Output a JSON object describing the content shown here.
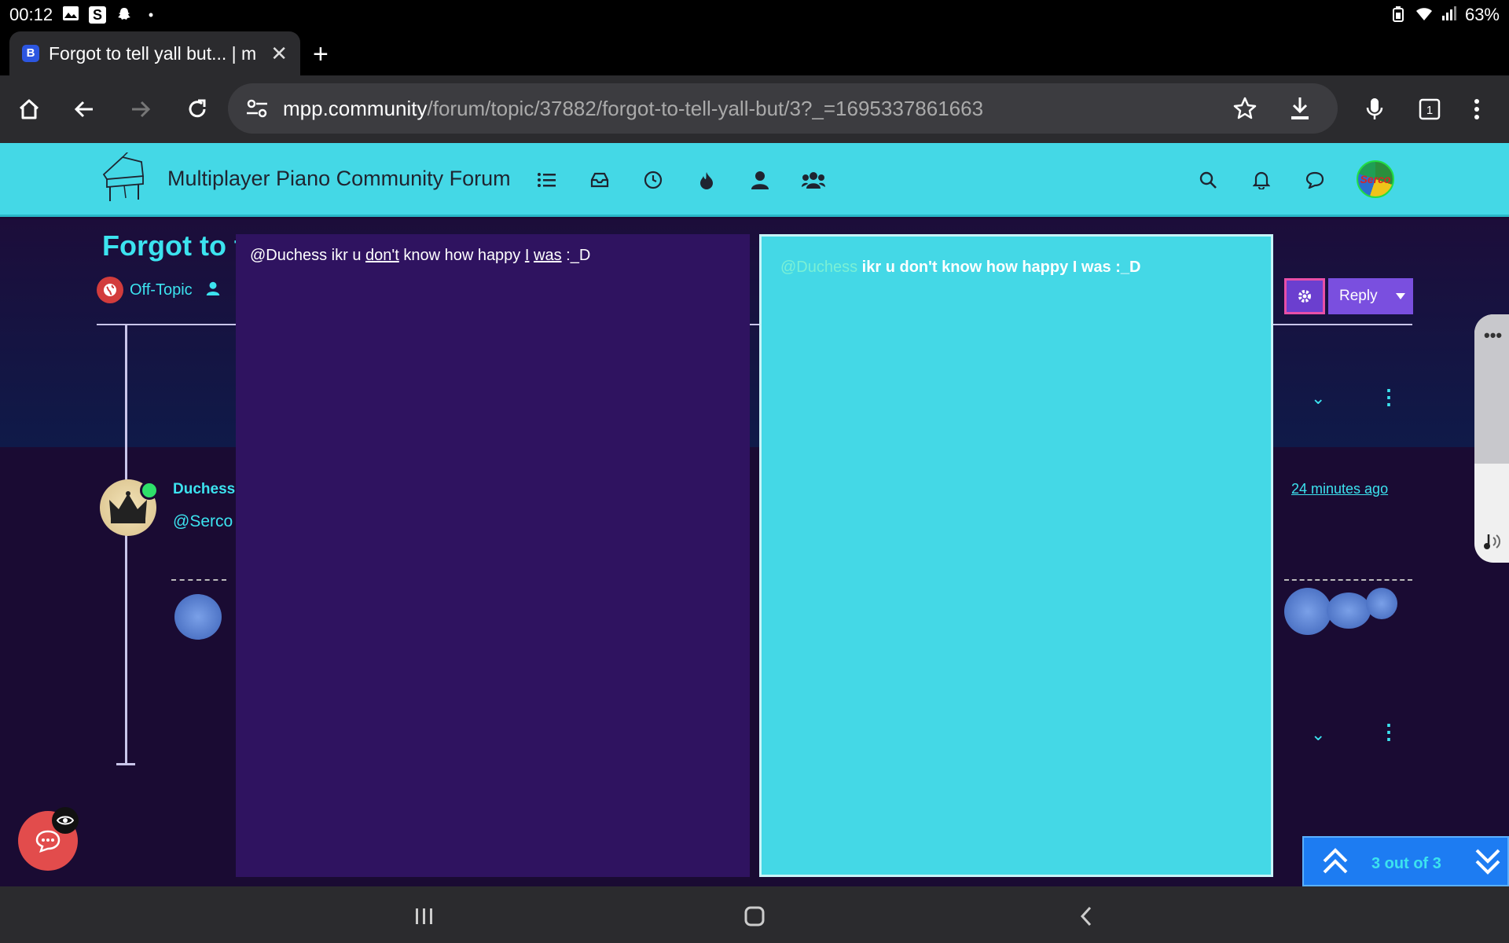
{
  "status_bar": {
    "time": "00:12",
    "battery": "63%"
  },
  "tab": {
    "favicon_letter": "B",
    "title": "Forgot to tell yall but... | m"
  },
  "toolbar": {
    "url_host": "mpp.community",
    "url_path": "/forum/topic/37882/forgot-to-tell-yall-but/3?_=1695337861663"
  },
  "forum": {
    "title": "Multiplayer Piano Community Forum",
    "avatar_text": "Serco"
  },
  "topic": {
    "title": "Forgot to t",
    "category": "Off-Topic"
  },
  "post": {
    "author": "Duchess",
    "mention_text": "@Serco",
    "time": "24 minutes ago"
  },
  "composer": {
    "write_prefix": "@Duchess ikr u ",
    "write_dont": "don't",
    "write_mid": " know how happy ",
    "write_i": "I",
    "write_space": " ",
    "write_was": "was",
    "write_suffix": " :_D",
    "preview_mention": "@Duchess",
    "preview_text": " ikr u don't know how happy I was :_D"
  },
  "actions": {
    "reply_label": "Reply"
  },
  "pagination": {
    "label": "3 out of 3"
  },
  "colors": {
    "header_bg": "#44d8e6",
    "page_bg": "#1a0b33",
    "accent": "#3ce3ef",
    "reply_btn": "#7a4fdf",
    "composer_write_bg": "#2f1360",
    "chat_fab": "#e24c4c",
    "pager_bg": "#1d7cf2"
  }
}
